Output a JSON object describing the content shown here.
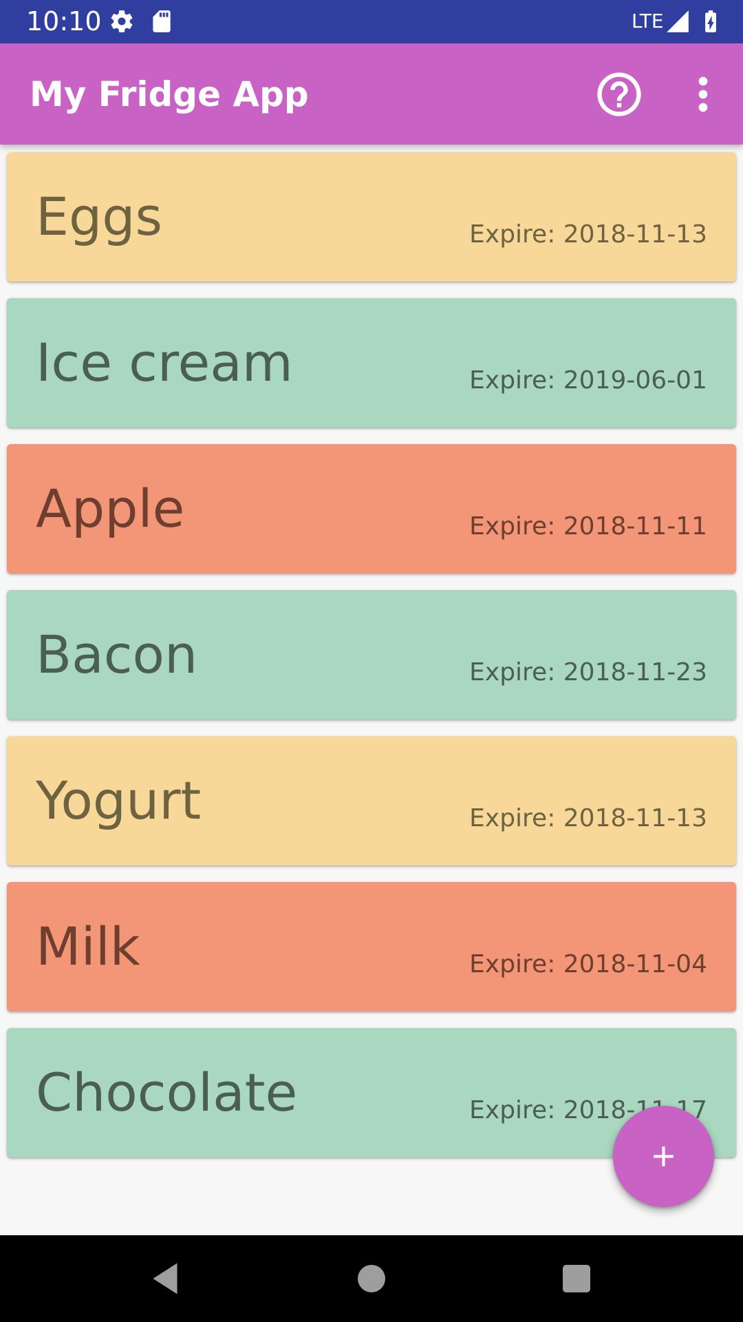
{
  "status_bar": {
    "time": "10:10",
    "network": "LTE",
    "icons": [
      "settings-icon",
      "sd-card-icon",
      "signal-icon",
      "battery-charging-icon"
    ],
    "background": "#303f9f"
  },
  "app_bar": {
    "title": "My Fridge App",
    "background": "#c862c5",
    "actions": [
      "help-icon",
      "more-vert-icon"
    ]
  },
  "items": [
    {
      "name": "Eggs",
      "expire": "Expire: 2018-11-13",
      "status": "soon"
    },
    {
      "name": "Ice cream",
      "expire": "Expire: 2019-06-01",
      "status": "ok"
    },
    {
      "name": "Apple",
      "expire": "Expire: 2018-11-11",
      "status": "expired"
    },
    {
      "name": "Bacon",
      "expire": "Expire: 2018-11-23",
      "status": "ok"
    },
    {
      "name": "Yogurt",
      "expire": "Expire: 2018-11-13",
      "status": "soon"
    },
    {
      "name": "Milk",
      "expire": "Expire: 2018-11-04",
      "status": "expired"
    },
    {
      "name": "Chocolate",
      "expire": "Expire: 2018-11-17",
      "status": "ok"
    }
  ],
  "status_colors": {
    "soon": {
      "background": "#f7d899",
      "text": "#6e6241"
    },
    "ok": {
      "background": "#a9d7bf",
      "text": "#4b5e52"
    },
    "expired": {
      "background": "#f29677",
      "text": "#6e3e2e"
    }
  },
  "fab": {
    "icon": "add-icon",
    "background": "#c862c5"
  },
  "nav_bar": {
    "buttons": [
      "back-icon",
      "home-icon",
      "recents-icon"
    ]
  }
}
